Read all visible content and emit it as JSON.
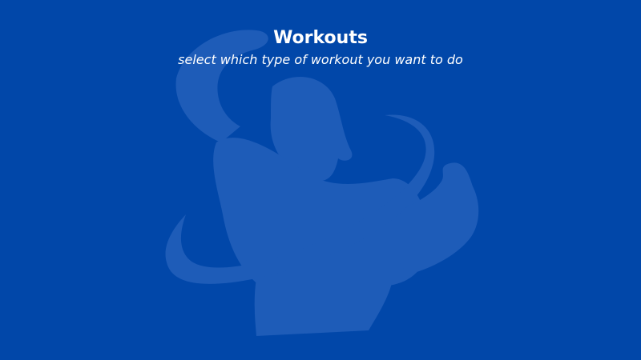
{
  "screen": {
    "background_color": "#0147a9",
    "watermark_color": "#1e5cb8",
    "watermark_icon": "flexing-bodybuilder-logo-icon"
  },
  "header": {
    "title": "Workouts",
    "subtitle": "select which type of workout you want to do"
  }
}
